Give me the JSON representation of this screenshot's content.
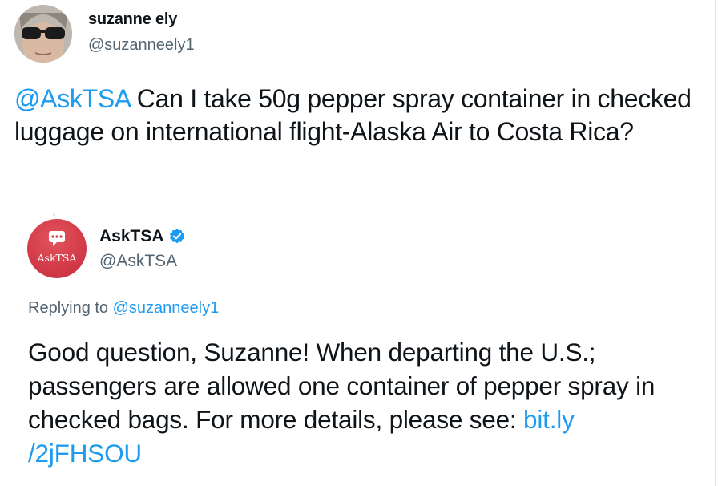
{
  "tweet": {
    "author_name": "suzanne ely",
    "author_handle": "@suzanneely1",
    "mention": "@AskTSA",
    "text": " Can I take 50g pepper spray container in checked luggage on international flight-Alaska Air to Costa Rica?"
  },
  "reply": {
    "author_name": "AskTSA",
    "author_handle": "@AskTSA",
    "avatar_text": "AskTSA",
    "verified_icon": "verified-badge-icon",
    "replying_prefix": "Replying to ",
    "replying_to": "@suzanneely1",
    "text": "Good question, Suzanne! When departing the U.S.; passengers are allowed one container of pepper spray in checked bags. For more details, please see: ",
    "link_part1": "bit.ly",
    "link_part2": "/2jFHSOU"
  },
  "colors": {
    "accent": "#1d9bf0",
    "secondary_text": "#536471",
    "primary_text": "#0f1419",
    "avatar_red": "#d23a48"
  }
}
